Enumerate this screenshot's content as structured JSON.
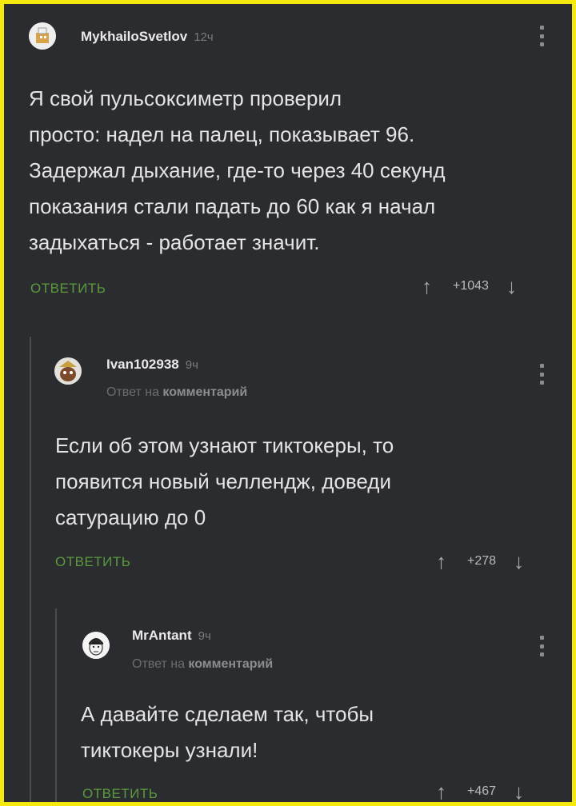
{
  "comments": [
    {
      "author": "MykhailoSvetlov",
      "time": "12ч",
      "text": "Я свой пульсоксиметр проверил\nпросто: надел на палец, показывает 96.\nЗадержал дыхание, где-то через 40 секунд\nпоказания стали падать до 60 как я начал\nзадыхаться - работает значит.",
      "reply_label": "ОТВЕТИТЬ",
      "score": "+1043"
    },
    {
      "author": "Ivan102938",
      "time": "9ч",
      "reply_prefix": "Ответ на",
      "reply_target": "комментарий",
      "text": "Если об этом узнают тиктокеры, то\nпоявится новый челлендж, доведи\nсатурацию до 0",
      "reply_label": "ОТВЕТИТЬ",
      "score": "+278"
    },
    {
      "author": "MrAntant",
      "time": "9ч",
      "reply_prefix": "Ответ на",
      "reply_target": "комментарий",
      "text": "А давайте сделаем так, чтобы\nтиктокеры узнали!",
      "reply_label": "ОТВЕТИТЬ",
      "score": "+467"
    }
  ],
  "icons": {
    "up": "upvote-arrow-icon",
    "down": "downvote-arrow-icon",
    "menu": "more-vertical-icon"
  },
  "colors": {
    "background": "#2b2c2f",
    "frame": "#f5e90d",
    "reply_button": "#5a9a3b"
  }
}
